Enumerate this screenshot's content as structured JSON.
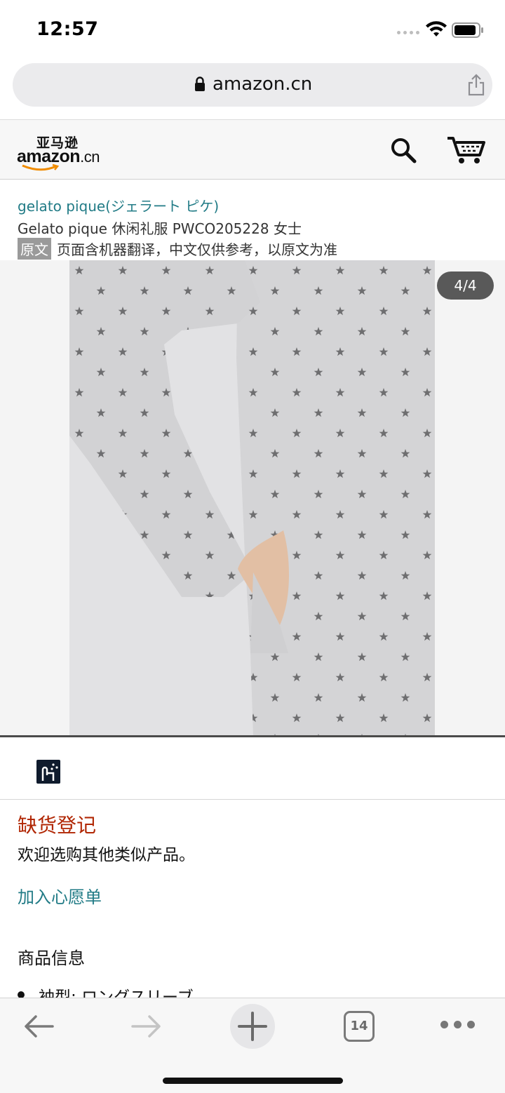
{
  "status_bar": {
    "time": "12:57"
  },
  "browser": {
    "url": "amazon.cn"
  },
  "header": {
    "logo_cn": "亚马逊",
    "logo_en": "amazon",
    "logo_suffix": ".cn"
  },
  "product": {
    "brand": "gelato pique(ジェラート ピケ)",
    "title": "Gelato pique 休闲礼服 PWCO205228 女士",
    "original_badge": "原文",
    "translation_note": "页面含机器翻译，中文仅供参考，以原文为准",
    "image_counter": "4/4"
  },
  "availability": {
    "title": "缺货登记",
    "subtitle": "欢迎选购其他类似产品。",
    "wishlist": "加入心愿单"
  },
  "info": {
    "heading": "商品信息",
    "bullets": [
      "袖型: ロングスリーブ"
    ]
  },
  "toolbar": {
    "tab_count": "14"
  },
  "colors": {
    "link": "#217b86",
    "out_of_stock": "#b12704",
    "badge_bg": "#595959"
  },
  "icons": [
    "lock-icon",
    "share-icon",
    "search-icon",
    "cart-icon",
    "touch-360-icon",
    "back-arrow-icon",
    "forward-arrow-icon",
    "plus-icon",
    "tabs-icon",
    "more-icon"
  ]
}
